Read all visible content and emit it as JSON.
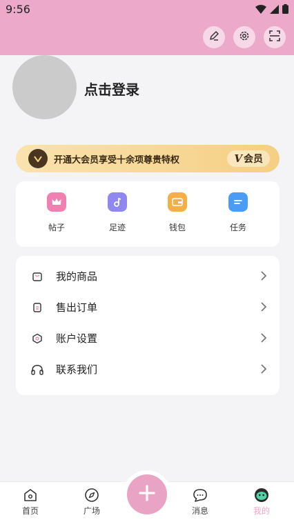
{
  "status_bar": {
    "time": "9:56"
  },
  "profile": {
    "login_text": "点击登录"
  },
  "vip": {
    "text": "开通大会员享受十余项尊贵特权",
    "pill_letter": "V",
    "pill_label": "会员"
  },
  "shortcuts": [
    {
      "label": "帖子",
      "icon": "crown-icon",
      "color": "#f07fb2"
    },
    {
      "label": "足迹",
      "icon": "music-note-icon",
      "color": "#8f88f0"
    },
    {
      "label": "钱包",
      "icon": "wallet-icon",
      "color": "#f6ae46"
    },
    {
      "label": "任务",
      "icon": "task-list-icon",
      "color": "#4a9cf5"
    }
  ],
  "menu": [
    {
      "label": "我的商品",
      "icon": "bag-icon"
    },
    {
      "label": "售出订单",
      "icon": "order-icon"
    },
    {
      "label": "账户设置",
      "icon": "hexagon-settings-icon"
    },
    {
      "label": "联系我们",
      "icon": "headphones-icon"
    }
  ],
  "bottom_nav": [
    {
      "label": "首页",
      "icon": "home-icon"
    },
    {
      "label": "广场",
      "icon": "compass-icon"
    },
    {
      "label": "消息",
      "icon": "chat-icon"
    },
    {
      "label": "我的",
      "icon": "face-icon",
      "active": true
    }
  ],
  "colors": {
    "accent": "#eda9c9",
    "vip_gold": "#f5cf83"
  }
}
